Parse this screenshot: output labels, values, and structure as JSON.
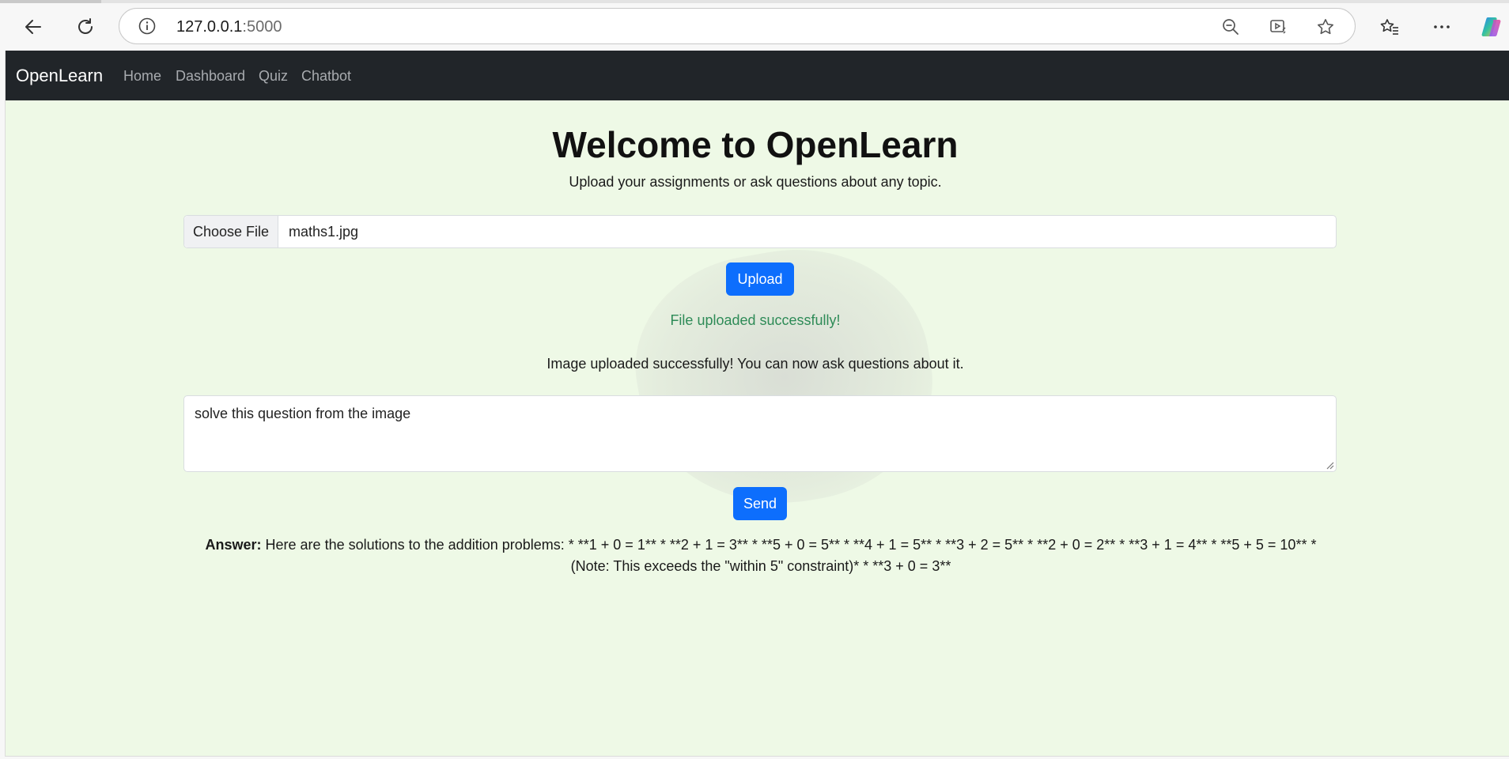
{
  "browser": {
    "url_host": "127.0.0.1",
    "url_port": ":5000",
    "icons": [
      "back-icon",
      "refresh-icon",
      "info-icon",
      "zoom-out-icon",
      "immersive-reader-icon",
      "favorite-star-icon",
      "favorites-icon",
      "more-icon",
      "copilot-icon"
    ]
  },
  "navbar": {
    "brand": "OpenLearn",
    "links": [
      "Home",
      "Dashboard",
      "Quiz",
      "Chatbot"
    ]
  },
  "main": {
    "title": "Welcome to OpenLearn",
    "subtitle": "Upload your assignments or ask questions about any topic.",
    "file_button": "Choose File",
    "file_name": "maths1.jpg",
    "upload_label": "Upload",
    "success_message": "File uploaded successfully!",
    "info_message": "Image uploaded successfully! You can now ask questions about it.",
    "question_value": "solve this question from the image",
    "send_label": "Send",
    "answer_label": "Answer:",
    "answer_line1": " Here are the solutions to the addition problems: * **1 + 0 = 1** * **2 + 1 = 3** * **5 + 0 = 5** * **4 + 1 = 5** * **3 + 2 = 5** * **2 + 0 = 2** * **3 + 1 = 4** * **5 + 5 = 10** *",
    "answer_line2": "(Note: This exceeds the \"within 5\" constraint)* * **3 + 0 = 3**"
  },
  "colors": {
    "page_bg": "#eef9e6",
    "navbar_bg": "#212529",
    "primary": "#0d6efd",
    "success": "#2e8b57"
  }
}
